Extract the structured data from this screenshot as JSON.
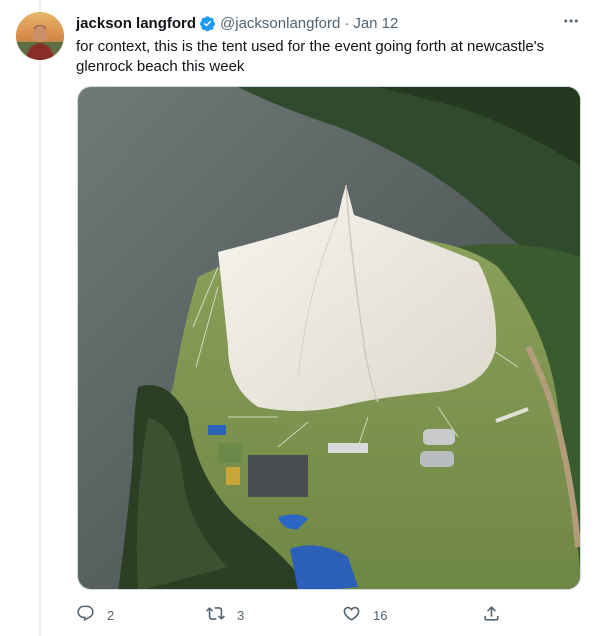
{
  "tweet": {
    "author": {
      "name": "jackson langford",
      "handle": "@jacksonlangford",
      "verified": true
    },
    "separator": "·",
    "date": "Jan 12",
    "text": "for context, this is the tent used for the event going forth at newcastle's glenrock beach this week",
    "media": {
      "kind": "photo",
      "subject": "aerial-view-large-white-tent-on-grassy-peninsula"
    }
  },
  "actions": {
    "reply_count": "2",
    "retweet_count": "3",
    "like_count": "16"
  },
  "colors": {
    "verified": "#1d9bf0",
    "secondary_text": "#536471",
    "border": "#cfd9de"
  },
  "icons": [
    "verified-badge-icon",
    "more-icon",
    "reply-icon",
    "retweet-icon",
    "like-icon",
    "share-icon"
  ]
}
